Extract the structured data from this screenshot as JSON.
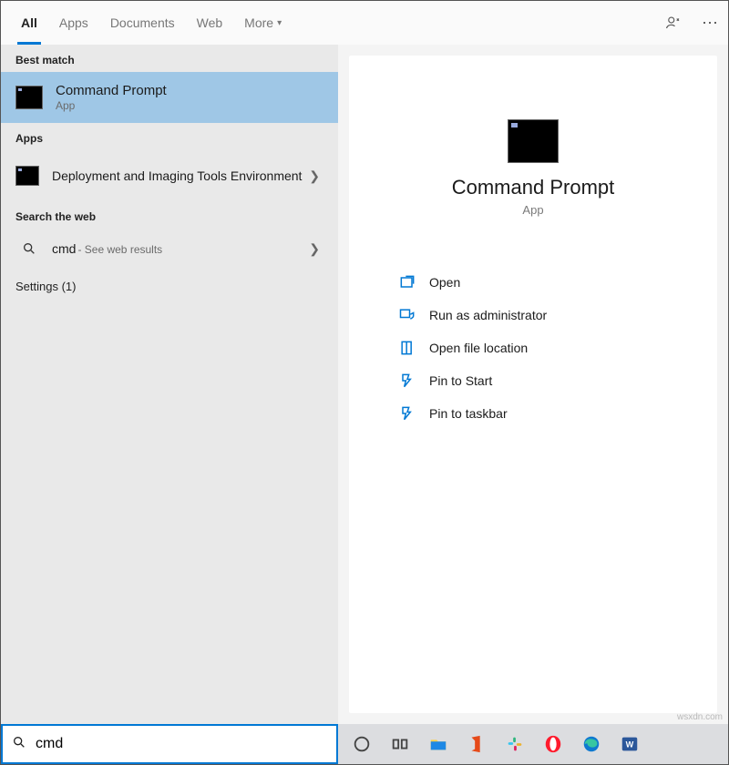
{
  "tabs": {
    "all": "All",
    "apps": "Apps",
    "documents": "Documents",
    "web": "Web",
    "more": "More"
  },
  "left": {
    "best_match_label": "Best match",
    "best": {
      "title": "Command Prompt",
      "sub": "App"
    },
    "apps_label": "Apps",
    "app1": {
      "title": "Deployment and Imaging Tools Environment"
    },
    "web_label": "Search the web",
    "web1": {
      "term": "cmd",
      "hint": " - See web results"
    },
    "settings_label": "Settings (1)"
  },
  "right": {
    "title": "Command Prompt",
    "sub": "App",
    "actions": {
      "open": "Open",
      "admin": "Run as administrator",
      "loc": "Open file location",
      "pin_start": "Pin to Start",
      "pin_taskbar": "Pin to taskbar"
    }
  },
  "search": {
    "value": "cmd"
  },
  "watermark": "wsxdn.com"
}
